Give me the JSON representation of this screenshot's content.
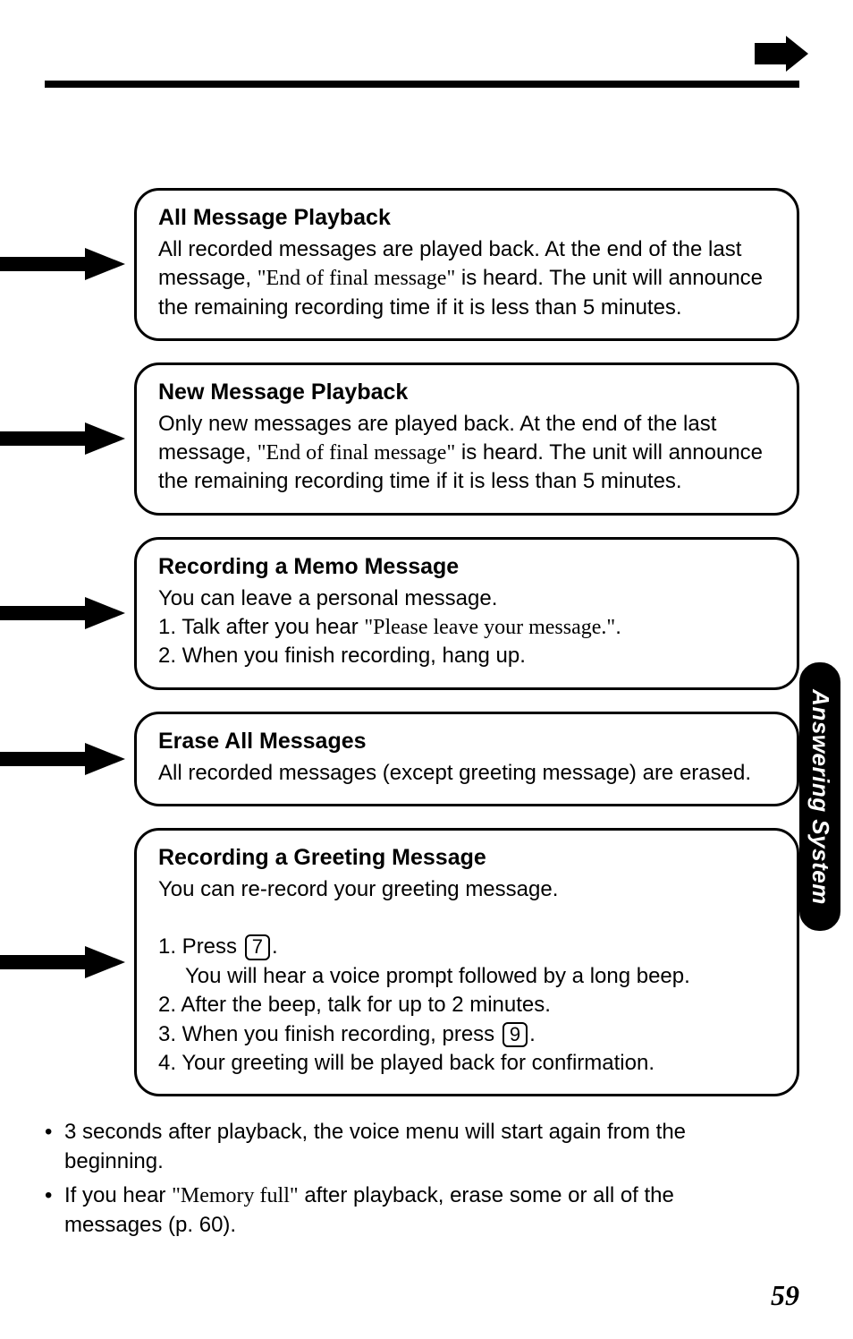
{
  "page_number": "59",
  "side_tab": "Answering System",
  "boxes": [
    {
      "title": "All Message Playback",
      "body_html": "All recorded messages are played back. At the end of the last message, <span class='quoted'>\"End of final message\"</span> is heard. The unit will announce the remaining recording time if it is less than 5 minutes."
    },
    {
      "title": "New Message Playback",
      "body_html": "Only new messages are played back. At the end of the last message, <span class='quoted'>\"End of final message\"</span> is heard. The unit will announce the remaining recording time if it is less than 5 minutes."
    },
    {
      "title": "Recording a Memo Message",
      "body_html": "You can leave a personal message.<br>1. Talk after you hear <span class='quoted'>\"Please leave your message.\"</span>.<br>2. When you finish recording, hang up."
    },
    {
      "title": "Erase All Messages",
      "body_html": "All recorded messages (except greeting message) are erased."
    },
    {
      "title": "Recording a Greeting Message",
      "body_html": "You can re-record your greeting message.<br><br><div class='step'>1. Press <span class='keycap'>7</span>.</div><div class='step-indent'>You will hear a voice prompt followed by a long beep.</div><div class='step'>2. After the beep, talk for up to 2 minutes.</div><div class='step'>3. When you finish recording, press <span class='keycap'>9</span>.</div><div class='step'>4. Your greeting will be played back for confirmation.</div>"
    }
  ],
  "bullets": [
    "3 seconds after playback, the voice menu will start again from the beginning.",
    "If you hear <span class='quoted'>\"Memory full\"</span> after playback, erase some or all of the messages (p. 60)."
  ]
}
